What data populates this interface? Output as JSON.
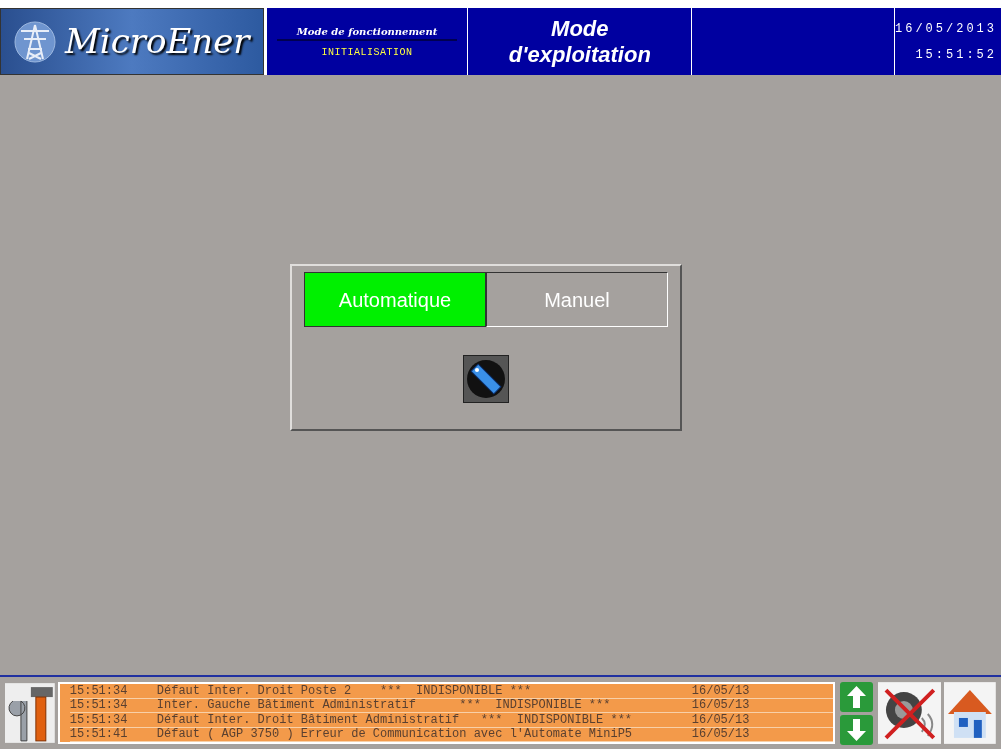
{
  "header": {
    "logo": "MicroEner",
    "mode_label": "Mode de fonctionnement",
    "mode_value": "INITIALISATION",
    "title_line_1": "Mode",
    "title_line_2": "d'exploitation",
    "date": "16/05/2013",
    "time": "15:51:52"
  },
  "mode_selector": {
    "options": [
      {
        "label": "Automatique",
        "selected": true
      },
      {
        "label": "Manuel",
        "selected": false
      }
    ]
  },
  "alarms": [
    {
      "time": "15:51:34",
      "message": "Défaut Inter. Droit Poste 2    ***  INDISPONIBLE ***",
      "date": "16/05/13"
    },
    {
      "time": "15:51:34",
      "message": "Inter. Gauche Bâtiment Administratif      ***  INDISPONIBLE ***",
      "date": "16/05/13"
    },
    {
      "time": "15:51:34",
      "message": "Défaut Inter. Droit Bâtiment Administratif   ***  INDISPONIBLE ***",
      "date": "16/05/13"
    },
    {
      "time": "15:51:41",
      "message": "Défaut ( AGP 3750 ) Erreur de Communication avec l'Automate MiniP5",
      "date": "16/05/13"
    }
  ]
}
